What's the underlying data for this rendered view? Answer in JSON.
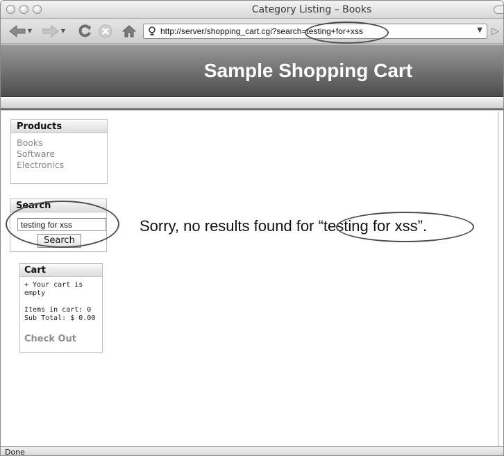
{
  "browser": {
    "window_title": "Category Listing – Books",
    "url": "http://server/shopping_cart.cgi?search=testing+for+xss",
    "status": "Done"
  },
  "icons": {
    "back": "back-arrow-icon",
    "forward": "forward-arrow-icon",
    "reload": "reload-icon",
    "stop": "stop-icon",
    "home": "home-icon",
    "site": "site-identity-icon",
    "url_dropdown": "chevron-down-icon",
    "go": "go-arrow-icon"
  },
  "page": {
    "banner_title": "Sample Shopping Cart",
    "products": {
      "heading": "Products",
      "items": [
        "Books",
        "Software",
        "Electronics"
      ]
    },
    "search": {
      "heading": "Search",
      "input_value": "testing for xss",
      "button_label": "Search"
    },
    "cart": {
      "heading": "Cart",
      "empty_line1": "+ Your cart is",
      "empty_line2": "empty",
      "items_line": "Items in cart: 0",
      "subtotal_line": "Sub Total: $ 0.00",
      "checkout_label": "Check Out"
    },
    "result_message": "Sorry, no results found for “testing for xss”."
  },
  "colors": {
    "banner_dark": "#4e4e4e",
    "banner_light": "#9a9a9a",
    "annotation_ring": "#4d4d4d",
    "muted_link": "#888888"
  }
}
